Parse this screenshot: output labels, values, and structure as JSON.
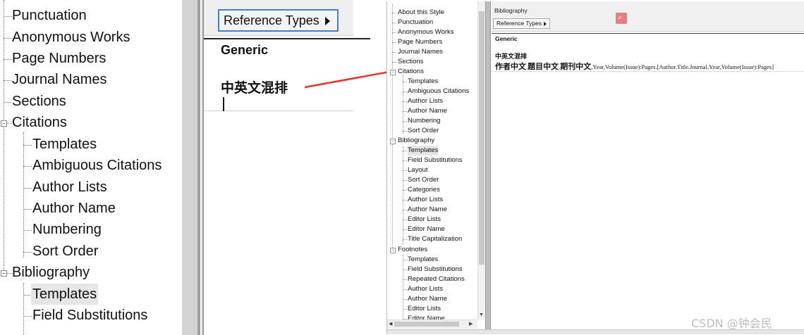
{
  "zoom_tree": {
    "items": [
      {
        "label": "Punctuation"
      },
      {
        "label": "Anonymous Works"
      },
      {
        "label": "Page Numbers"
      },
      {
        "label": "Journal Names"
      },
      {
        "label": "Sections"
      },
      {
        "label": "Citations"
      },
      {
        "label": "Templates"
      },
      {
        "label": "Ambiguous Citations"
      },
      {
        "label": "Author Lists"
      },
      {
        "label": "Author Name"
      },
      {
        "label": "Numbering"
      },
      {
        "label": "Sort Order"
      },
      {
        "label": "Bibliography"
      },
      {
        "label": "Templates"
      },
      {
        "label": "Field Substitutions"
      }
    ],
    "selected_index": 13
  },
  "zoom_editor": {
    "reference_types_label": "Reference Types",
    "generic_label": "Generic",
    "template_line": "中英文混排"
  },
  "small_window": {
    "tree": {
      "items": [
        {
          "label": "About this Style"
        },
        {
          "label": "Punctuation"
        },
        {
          "label": "Anonymous Works"
        },
        {
          "label": "Page Numbers"
        },
        {
          "label": "Journal Names"
        },
        {
          "label": "Sections"
        },
        {
          "label": "Citations"
        },
        {
          "label": "Templates"
        },
        {
          "label": "Ambiguous Citations"
        },
        {
          "label": "Author Lists"
        },
        {
          "label": "Author Name"
        },
        {
          "label": "Numbering"
        },
        {
          "label": "Sort Order"
        },
        {
          "label": "Bibliography"
        },
        {
          "label": "Templates"
        },
        {
          "label": "Field Substitutions"
        },
        {
          "label": "Layout"
        },
        {
          "label": "Sort Order"
        },
        {
          "label": "Categories"
        },
        {
          "label": "Author Lists"
        },
        {
          "label": "Author Name"
        },
        {
          "label": "Editor Lists"
        },
        {
          "label": "Editor Name"
        },
        {
          "label": "Title Capitalization"
        },
        {
          "label": "Footnotes"
        },
        {
          "label": "Templates"
        },
        {
          "label": "Field Substitutions"
        },
        {
          "label": "Repeated Citations"
        },
        {
          "label": "Author Lists"
        },
        {
          "label": "Author Name"
        },
        {
          "label": "Editor Lists"
        },
        {
          "label": "Editor Name"
        }
      ],
      "selected_index": 14
    },
    "editor": {
      "section_title": "Bibliography",
      "reference_types_label": "Reference Types",
      "generic_label": "Generic",
      "template_heading": "中英文混排",
      "template_cn_part1": "作者中文",
      "template_sep1": ".",
      "template_cn_part2": "题目中文",
      "template_sep2": ".",
      "template_cn_part3": "期刊中文",
      "template_rest": ",Year,Volume(Issue):Pages.[Author.Title.Journal,Year,Volume(Issue):Pages]"
    }
  },
  "watermark": "CSDN @钟会民",
  "colors": {
    "arrow": "#e8312a",
    "focus_border": "#3c7fd6",
    "selection": "#e6e6e6"
  }
}
